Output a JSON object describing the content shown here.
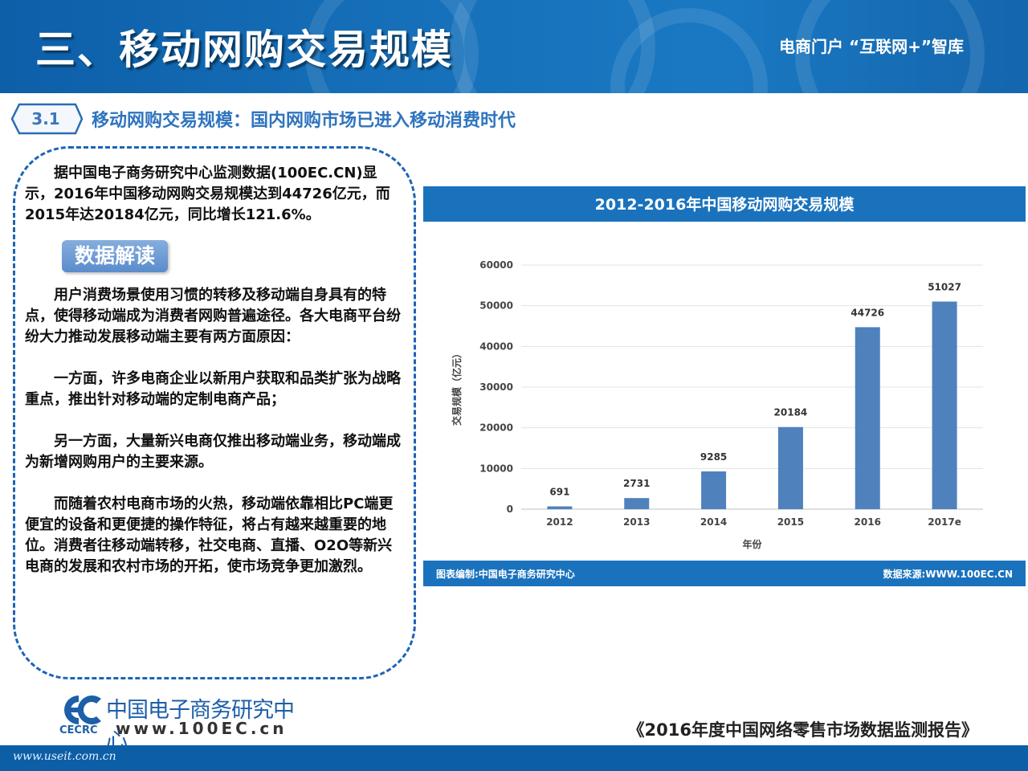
{
  "header": {
    "title": "三、移动网购交易规模",
    "tagline": "电商门户  “互联网+”智库"
  },
  "section": {
    "number": "3.1",
    "title": "移动网购交易规模：国内网购市场已进入移动消费时代"
  },
  "textbox": {
    "intro": "据中国电子商务研究中心监测数据(100EC.CN)显示，2016年中国移动网购交易规模达到44726亿元，而2015年达20184亿元，同比增长121.6%。",
    "pill": "数据解读",
    "p1": "用户消费场景使用习惯的转移及移动端自身具有的特点，使得移动端成为消费者网购普遍途径。各大电商平台纷纷大力推动发展移动端主要有两方面原因：",
    "p2": "一方面，许多电商企业以新用户获取和品类扩张为战略重点，推出针对移动端的定制电商产品；",
    "p3": "另一方面，大量新兴电商仅推出移动端业务，移动端成为新增网购用户的主要来源。",
    "p4": "而随着农村电商市场的火热，移动端依靠相比PC端更便宜的设备和更便捷的操作特征，将占有越来越重要的地位。消费者往移动端转移，社交电商、直播、O2O等新兴电商的发展和农村市场的开拓，使市场竞争更加激烈。"
  },
  "chart_data": {
    "type": "bar",
    "title": "2012-2016年中国移动网购交易规模",
    "categories": [
      "2012",
      "2013",
      "2014",
      "2015",
      "2016",
      "2017e"
    ],
    "values": [
      691,
      2731,
      9285,
      20184,
      44726,
      51027
    ],
    "data_labels": [
      "691",
      "2731",
      "9285",
      "20184",
      "44726",
      "51027"
    ],
    "xlabel": "年份",
    "ylabel": "交易规模（亿元）",
    "ylim": [
      0,
      60000
    ],
    "yticks": [
      "0",
      "10000",
      "20000",
      "30000",
      "40000",
      "50000",
      "60000"
    ],
    "bar_color": "#4f81bd",
    "grid": true,
    "source_left": "图表编制:中国电子商务研究中心",
    "source_right": "数据来源:WWW.100EC.CN"
  },
  "logo": {
    "name": "中国电子商务研究中心",
    "abbr": "CECRC",
    "url": "www.100EC.cn"
  },
  "report": "《2016年度中国网络零售市场数据监测报告》",
  "footer": {
    "site": "www.useit.com.cn"
  },
  "colors": {
    "primary": "#1a72bd",
    "accent": "#2f74bf"
  }
}
